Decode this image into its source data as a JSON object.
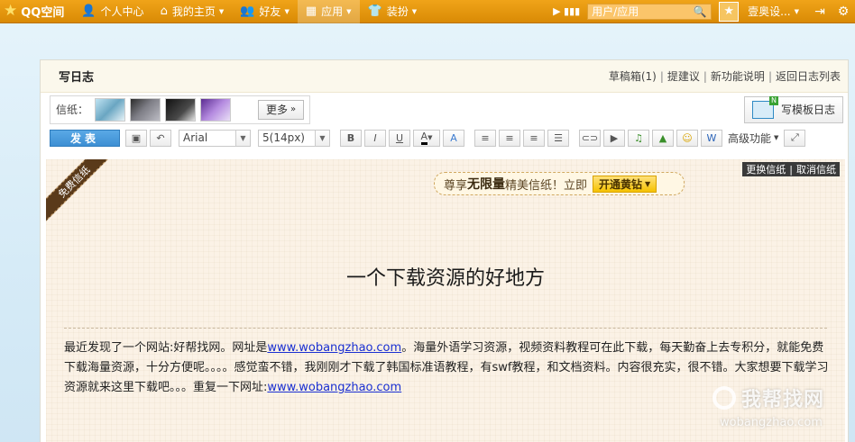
{
  "topbar": {
    "logo": "QQ空间",
    "nav": [
      {
        "icon": "person-icon",
        "label": "个人中心"
      },
      {
        "icon": "home-icon",
        "label": "我的主页"
      },
      {
        "icon": "friends-icon",
        "label": "好友"
      },
      {
        "icon": "grid-icon",
        "label": "应用"
      },
      {
        "icon": "shirt-icon",
        "label": "装扮"
      }
    ],
    "search_placeholder": "用户/应用",
    "username": "壹奥设..."
  },
  "panel": {
    "title": "写日志",
    "links": [
      "草稿箱(1)",
      "提建议",
      "新功能说明",
      "返回日志列表"
    ]
  },
  "stationery": {
    "label": "信纸：",
    "more": "更多",
    "template_button": "写模板日志"
  },
  "toolbar": {
    "publish": "发表",
    "font": "Arial",
    "size": "5(14px)",
    "advanced": "高级功能"
  },
  "editor": {
    "ribbon": "免费信纸",
    "promo_prefix": "尊享",
    "promo_bold": "无限量",
    "promo_suffix": "精美信纸！立即",
    "promo_button": "开通黄钻",
    "change_stationery": "更换信纸",
    "cancel_stationery": "取消信纸",
    "heading": "一个下载资源的好地方",
    "body_part1": "最近发现了一个网站:好帮找网。网址是",
    "link1": "www.wobangzhao.com",
    "body_part2": "。海量外语学习资源，视频资料教程可在此下载，每天勤奋上去专积分，就能免费下载海量资源，十分方便呢。。。。感觉蛮不错，我刚刚才下载了韩国标准语教程，有swf教程，和文档资料。内容很充实，很不错。大家想要下载学习资源就来这里下载吧。。。重复一下网址:",
    "link2": "www.wobangzhao.com"
  },
  "watermark": {
    "line1": "我帮找网",
    "line2": "wobangzhao.com"
  },
  "colors": {
    "topbar": "#e6980f",
    "publish": "#4a9bdc",
    "link": "#1a2fd1",
    "editor_bg": "#fbf2e6"
  }
}
